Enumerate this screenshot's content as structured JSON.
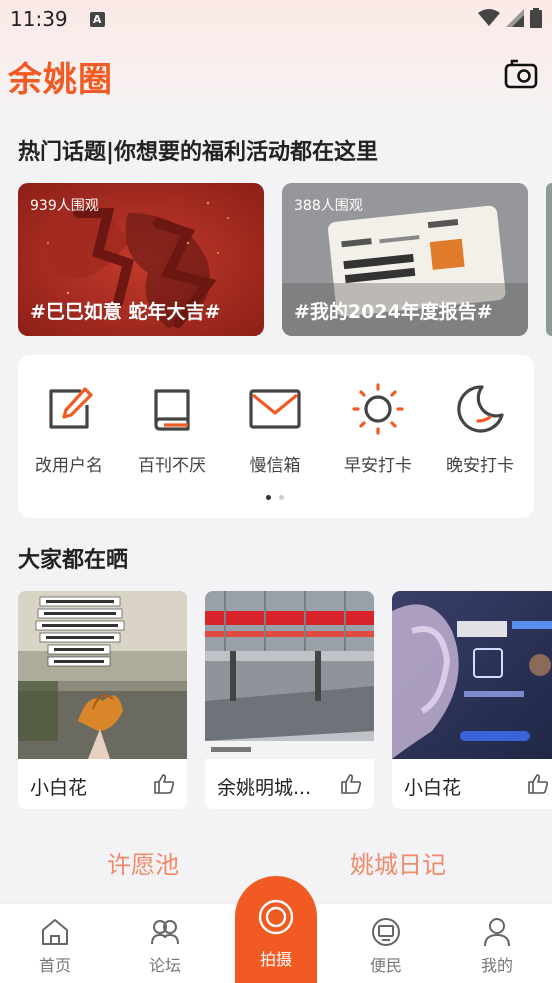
{
  "status_bar": {
    "time": "11:39",
    "notification_letter": "A"
  },
  "header": {
    "app_title": "余姚圈"
  },
  "topics": {
    "title": "热门话题|你想要的福利活动都在这里",
    "cards": [
      {
        "views": "939人围观",
        "label": "#巳巳如意  蛇年大吉#"
      },
      {
        "views": "388人围观",
        "label": "#我的2024年度报告#"
      }
    ]
  },
  "quick_actions": [
    {
      "label": "改用户名",
      "icon": "edit-icon"
    },
    {
      "label": "百刊不厌",
      "icon": "book-icon"
    },
    {
      "label": "慢信箱",
      "icon": "mail-icon"
    },
    {
      "label": "早安打卡",
      "icon": "sun-icon"
    },
    {
      "label": "晚安打卡",
      "icon": "moon-icon"
    }
  ],
  "shares": {
    "title": "大家都在晒",
    "items": [
      {
        "name": "小白花"
      },
      {
        "name": "余姚明城..."
      },
      {
        "name": "小白花"
      }
    ]
  },
  "bottom_sections": [
    {
      "title": "许愿池"
    },
    {
      "title": "姚城日记"
    }
  ],
  "nav": {
    "home": "首页",
    "forum": "论坛",
    "shoot": "拍摄",
    "services": "便民",
    "mine": "我的"
  },
  "colors": {
    "brand": "#f15a22",
    "accent_light": "#f08a6b"
  }
}
